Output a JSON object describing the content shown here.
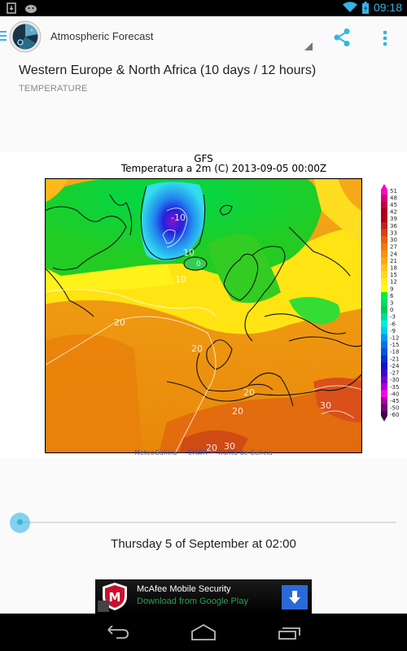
{
  "statusbar": {
    "time": "09:18",
    "left_icons": [
      "download-notification-icon",
      "android-notification-icon"
    ],
    "right_icons": [
      "wifi-icon",
      "battery-charging-icon"
    ]
  },
  "actionbar": {
    "title": "Atmospheric Forecast",
    "icons": [
      "drawer-indicator-icon",
      "app-logo-icon",
      "share-icon",
      "overflow-menu-icon"
    ],
    "accent_color": "#33b5e5"
  },
  "content": {
    "heading": "Western Europe & North Africa (10 days / 12 hours)",
    "subheading": "TEMPERATURE"
  },
  "map": {
    "model": "GFS",
    "title": "Temperatura a 2m (C) 2013-09-05 00:00Z",
    "credits": "MeteoGalicia — CMATI — Xunta de Galicia",
    "contour_labels": [
      "-10",
      "10",
      "0",
      "10",
      "20",
      "20",
      "20",
      "20",
      "20",
      "30",
      "30"
    ],
    "colorbar": {
      "labels": [
        "51",
        "48",
        "45",
        "42",
        "39",
        "36",
        "33",
        "30",
        "27",
        "24",
        "21",
        "18",
        "15",
        "12",
        "9",
        "6",
        "3",
        "0",
        "-3",
        "-6",
        "-9",
        "-12",
        "-15",
        "-18",
        "-21",
        "-24",
        "-27",
        "-30",
        "-35",
        "-40",
        "-45",
        "-50",
        "-60"
      ],
      "colors": [
        "#ff00cc",
        "#d6007a",
        "#c0004a",
        "#a80020",
        "#b3001a",
        "#c4201a",
        "#d8401a",
        "#e86010",
        "#ee7a10",
        "#f59010",
        "#f8a814",
        "#fcc41a",
        "#ffd820",
        "#ffee20",
        "#ffff00",
        "#00ee44",
        "#00dd66",
        "#00cc55",
        "#00dd99",
        "#00eedd",
        "#00ccee",
        "#0099ee",
        "#0077dd",
        "#0055dd",
        "#0033cc",
        "#1111cc",
        "#4400cc",
        "#7700cc",
        "#aa00dd",
        "#ff00ee",
        "#aa0099",
        "#770077",
        "#440044"
      ]
    }
  },
  "timeline": {
    "position_fraction": 0,
    "date_label": "Thursday 5 of September at 02:00"
  },
  "ad": {
    "title": "McAfee Mobile Security",
    "subtitle": "Download from Google Play",
    "icons": [
      "mcafee-logo-icon",
      "download-arrow-icon",
      "ad-info-icon"
    ]
  },
  "navbar": {
    "buttons": [
      "back",
      "home",
      "recent-apps"
    ]
  }
}
